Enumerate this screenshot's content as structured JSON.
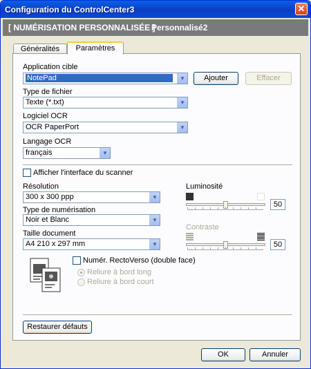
{
  "window": {
    "title": "Configuration du ControlCenter3"
  },
  "header": {
    "left": "[  NUMÉRISATION PERSONNALISÉE  ]",
    "right": "Personnalisé2"
  },
  "tabs": [
    {
      "label": "Généralités"
    },
    {
      "label": "Paramètres"
    }
  ],
  "target_app": {
    "label": "Application cible",
    "value": "NotePad",
    "add_label": "Ajouter",
    "delete_label": "Effacer"
  },
  "file_type": {
    "label": "Type de fichier",
    "value": "Texte (*.txt)"
  },
  "ocr_software": {
    "label": "Logiciel OCR",
    "value": "OCR PaperPort"
  },
  "ocr_language": {
    "label": "Langage OCR",
    "value": "français"
  },
  "show_scanner": {
    "label": "Afficher l'interface du scanner"
  },
  "resolution": {
    "label": "Résolution",
    "value": "300 x 300 ppp"
  },
  "scan_type": {
    "label": "Type de numérisation",
    "value": "Noir et Blanc"
  },
  "doc_size": {
    "label": "Taille document",
    "value": "A4 210 x 297 mm"
  },
  "brightness": {
    "label": "Luminosité",
    "value": "50"
  },
  "contrast": {
    "label": "Contraste",
    "value": "50"
  },
  "duplex": {
    "label": "Numér. RectoVerso (double face)",
    "long_edge": "Reliure à bord long",
    "short_edge": "Reliure à bord court"
  },
  "footer": {
    "restore_label": "Restaurer défauts",
    "ok_label": "OK",
    "cancel_label": "Annuler"
  }
}
